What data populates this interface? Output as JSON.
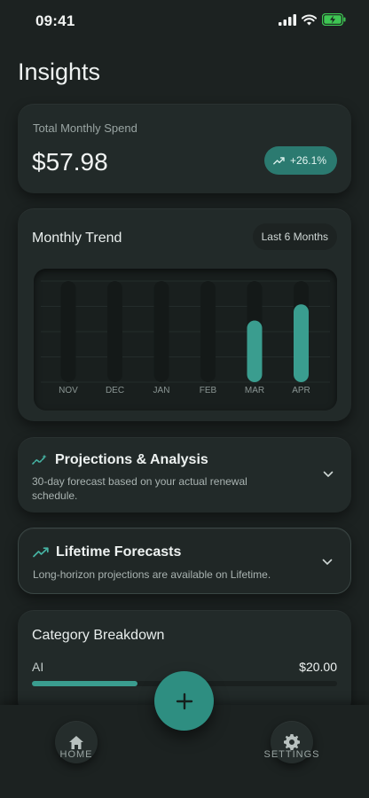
{
  "status": {
    "time": "09:41"
  },
  "page": {
    "title": "Insights"
  },
  "spend": {
    "label": "Total Monthly Spend",
    "amount": "$57.98",
    "change": "+26.1%"
  },
  "trend": {
    "title": "Monthly Trend",
    "range": "Last 6 Months"
  },
  "chart_data": {
    "type": "bar",
    "categories": [
      "NOV",
      "DEC",
      "JAN",
      "FEB",
      "MAR",
      "APR"
    ],
    "values": [
      0,
      0,
      0,
      0,
      0.61,
      0.77
    ],
    "ylim": [
      0,
      1
    ],
    "grid": true,
    "bar_color": "#3a9d8f"
  },
  "projections": {
    "title": "Projections & Analysis",
    "subtitle": "30-day forecast based on your actual renewal schedule."
  },
  "lifetime": {
    "title": "Lifetime Forecasts",
    "subtitle": "Long-horizon projections are available on Lifetime."
  },
  "category": {
    "title": "Category Breakdown",
    "items": [
      {
        "name": "AI",
        "value": "$20.00",
        "share": 0.345
      }
    ]
  },
  "nav": {
    "home_label": "HOME",
    "settings_label": "SETTINGS"
  },
  "colors": {
    "accent": "#2e8e81",
    "background": "#1c2221"
  },
  "icons": [
    "trend-up-icon",
    "sparkle-trend-icon",
    "chevron-down-icon",
    "home-icon",
    "gear-icon",
    "plus-icon"
  ]
}
